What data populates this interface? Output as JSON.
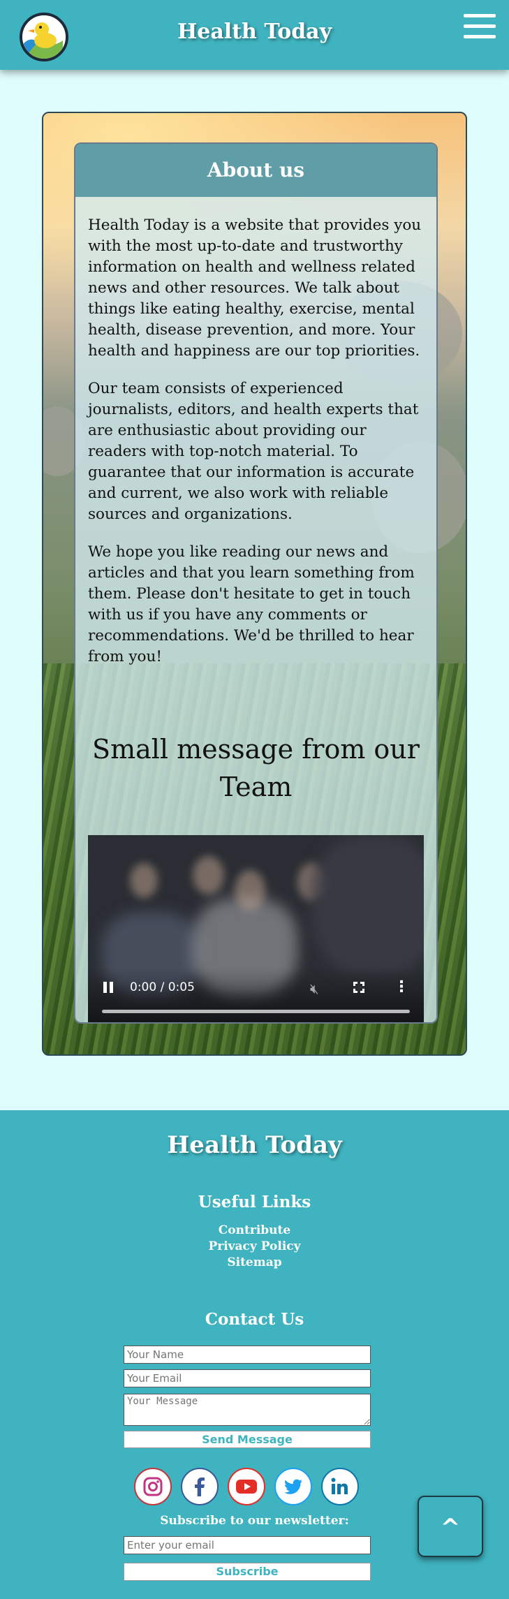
{
  "header": {
    "title": "Health Today",
    "logo_icon": "duck-logo-icon",
    "menu_icon": "hamburger-menu-icon"
  },
  "about": {
    "heading": "About us",
    "paragraphs": [
      "Health Today is a website that provides you with the most up-to-date and trustworthy information on health and wellness related news and other resources. We talk about things like eating healthy, exercise, mental health, disease prevention, and more. Your health and happiness are our top priorities.",
      "Our team consists of experienced journalists, editors, and health experts that are enthusiastic about providing our readers with top-notch material. To guarantee that our information is accurate and current, we also work with reliable sources and organizations.",
      "We hope you like reading our news and articles and that you learn something from them. Please don't hesitate to get in touch with us if you have any comments or recommendations. We'd be thrilled to hear from you!"
    ],
    "team_heading": "Small message from our Team"
  },
  "video": {
    "time": "0:00 / 0:05",
    "progress": 0
  },
  "footer": {
    "title": "Health Today",
    "useful_heading": "Useful Links",
    "links": [
      "Contribute",
      "Privacy Policy",
      "Sitemap"
    ],
    "contact_heading": "Contact Us",
    "name_placeholder": "Your Name",
    "email_placeholder": "Your Email",
    "message_placeholder": "Your Message",
    "send_label": "Send Message",
    "socials": [
      "instagram-icon",
      "facebook-icon",
      "youtube-icon",
      "twitter-icon",
      "linkedin-icon"
    ],
    "subscribe_label": "Subscribe to our newsletter:",
    "newsletter_placeholder": "Enter your email",
    "subscribe_button": "Subscribe"
  },
  "back_to_top": "^",
  "colors": {
    "header_bg": "#3fb3bf",
    "page_bg": "#dffdfc",
    "about_header_bg": "#5f9ea6"
  }
}
